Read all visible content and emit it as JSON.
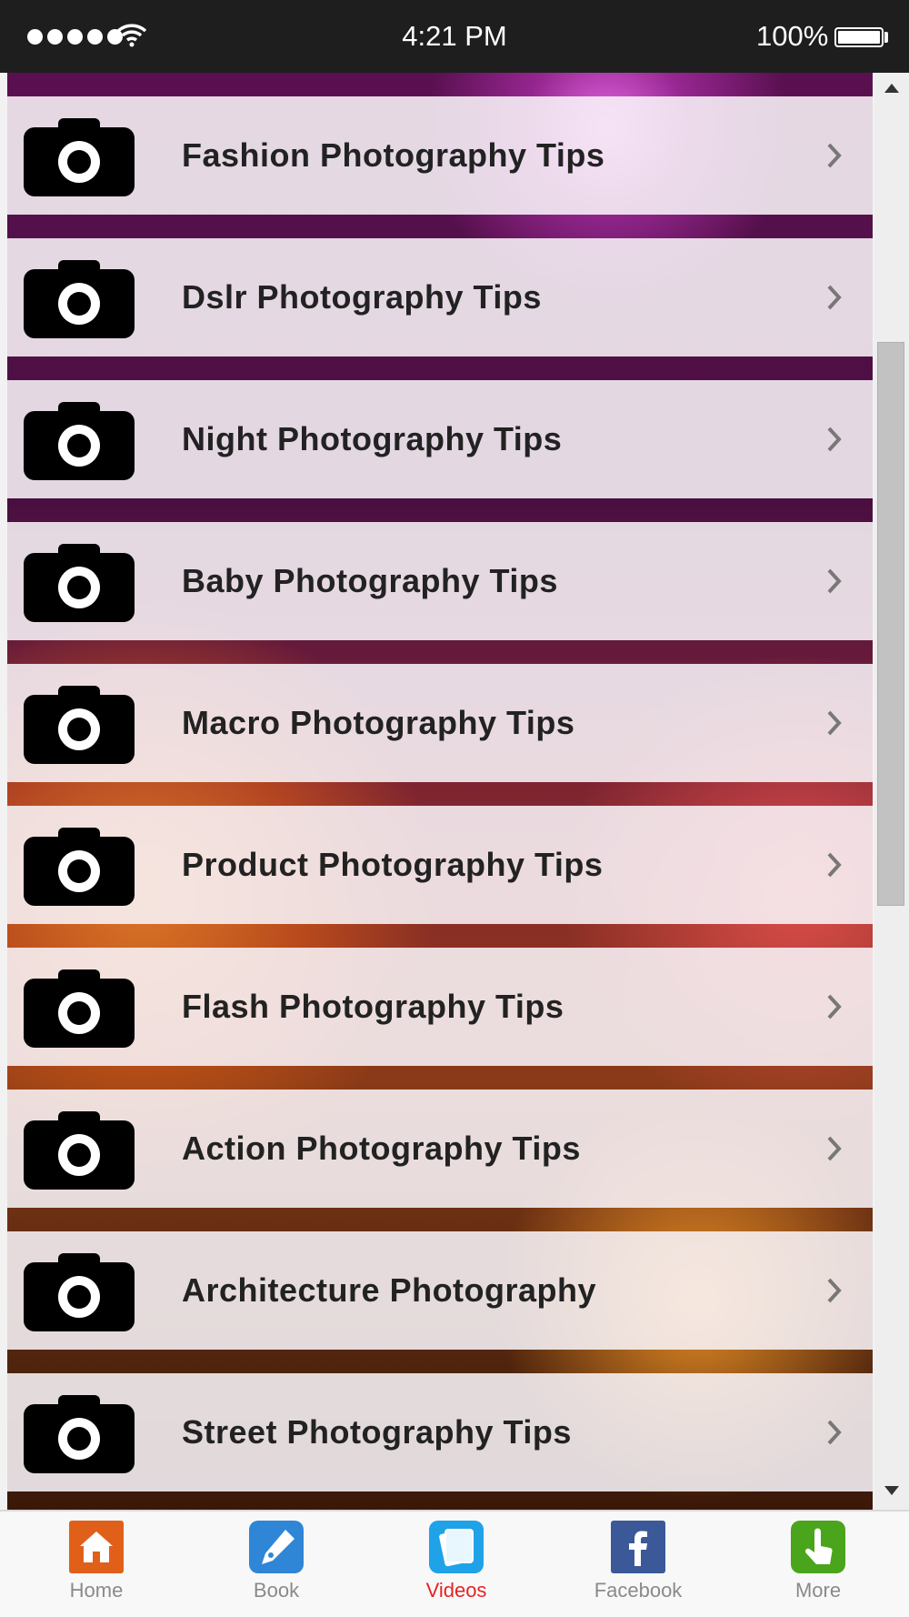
{
  "status_bar": {
    "time": "4:21 PM",
    "battery": "100%"
  },
  "list": {
    "items": [
      {
        "label": "Fashion Photography Tips",
        "icon": "camera-icon"
      },
      {
        "label": "Dslr Photography Tips",
        "icon": "camera-icon"
      },
      {
        "label": "Night Photography Tips",
        "icon": "camera-icon"
      },
      {
        "label": "Baby Photography Tips",
        "icon": "camera-icon"
      },
      {
        "label": "Macro Photography Tips",
        "icon": "camera-icon"
      },
      {
        "label": "Product Photography Tips",
        "icon": "camera-icon"
      },
      {
        "label": "Flash Photography Tips",
        "icon": "camera-icon"
      },
      {
        "label": "Action Photography Tips",
        "icon": "camera-icon"
      },
      {
        "label": "Architecture Photography",
        "icon": "camera-icon"
      },
      {
        "label": "Street Photography Tips",
        "icon": "camera-icon"
      }
    ]
  },
  "tab_bar": {
    "tabs": [
      {
        "label": "Home",
        "icon": "home-icon",
        "color": "#e0601a",
        "active": false
      },
      {
        "label": "Book",
        "icon": "pen-icon",
        "color": "#2f86d6",
        "active": false
      },
      {
        "label": "Videos",
        "icon": "videos-icon",
        "color": "#1fa2e8",
        "active": true
      },
      {
        "label": "Facebook",
        "icon": "facebook-icon",
        "color": "#3b5998",
        "active": false
      },
      {
        "label": "More",
        "icon": "more-hand-icon",
        "color": "#4aa51c",
        "active": false
      }
    ],
    "active_color": "#e52424"
  }
}
